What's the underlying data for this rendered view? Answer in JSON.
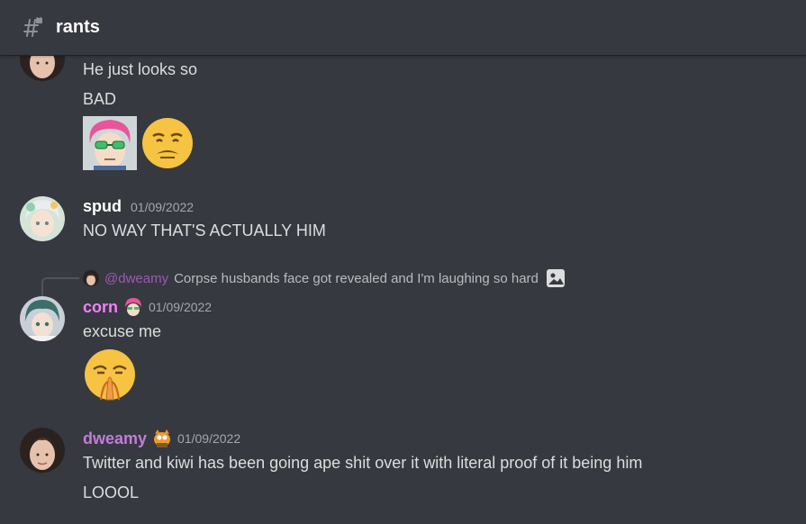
{
  "channel": {
    "name": "rants",
    "icon": "locked-hashtag-icon"
  },
  "messages": [
    {
      "id": "m1",
      "author": "",
      "lines": [
        "He just looks so",
        "BAD"
      ],
      "emojis": [
        "saiki-emoji",
        "disgusted-face-emoji"
      ]
    },
    {
      "id": "m2",
      "author": "spud",
      "author_color": "#ffffff",
      "timestamp": "01/09/2022",
      "lines": [
        "NO WAY THAT'S ACTUALLY HIM"
      ]
    },
    {
      "id": "m3",
      "reply": {
        "mention": "@dweamy",
        "text": "Corpse husbands face got revealed and I'm laughing so hard",
        "icon": "image-icon"
      },
      "author": "corn",
      "author_color": "#f47fff",
      "timestamp": "01/09/2022",
      "lines": [
        "excuse me"
      ],
      "emojis": [
        "praying-face-emoji"
      ]
    },
    {
      "id": "m4",
      "author": "dweamy",
      "author_color": "#c27cdb",
      "timestamp": "01/09/2022",
      "lines": [
        "Twitter and kiwi has been going ape shit over it with literal proof of it being him",
        "LOOOL"
      ]
    }
  ]
}
